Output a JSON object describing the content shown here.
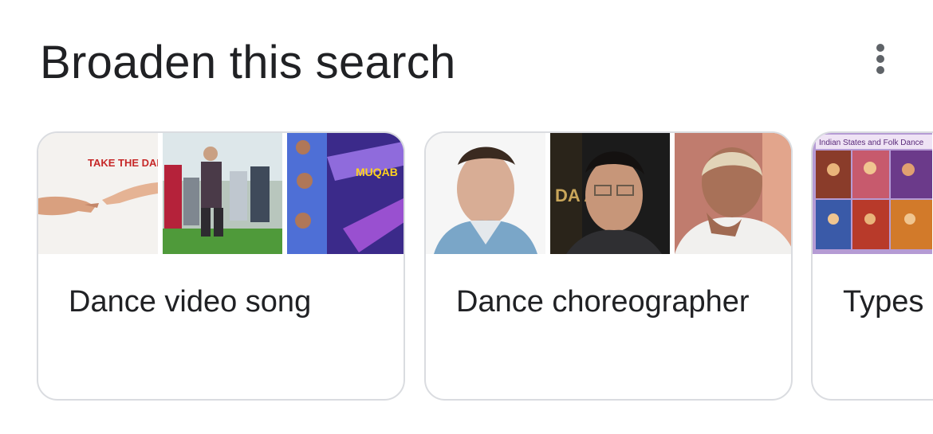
{
  "section": {
    "title": "Broaden this search",
    "menu_icon": "more-vert-icon"
  },
  "cards": [
    {
      "label": "Dance video song",
      "thumb_texts": [
        "TAKE THE DANCING",
        "MUQAB"
      ]
    },
    {
      "label": "Dance choreographer",
      "thumb_texts": [
        "DA AN"
      ]
    },
    {
      "label": "Types of dance art",
      "thumb_texts": [
        "Indian States and Folk Dance"
      ]
    }
  ]
}
